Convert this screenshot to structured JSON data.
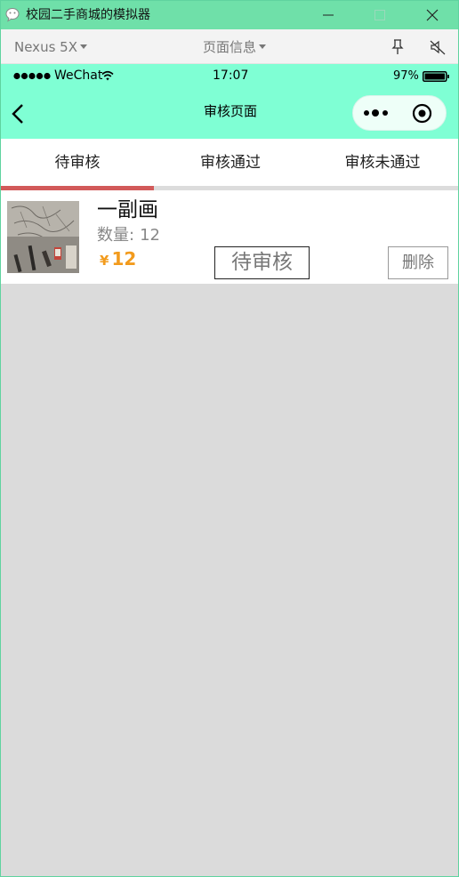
{
  "window": {
    "title": "校园二手商城的模拟器"
  },
  "toolbar": {
    "device": "Nexus 5X",
    "page_info": "页面信息"
  },
  "statusbar": {
    "carrier": "WeChat",
    "time": "17:07",
    "battery": "97%"
  },
  "navbar": {
    "title": "审核页面"
  },
  "tabs": [
    {
      "label": "待审核",
      "active": true
    },
    {
      "label": "审核通过",
      "active": false
    },
    {
      "label": "审核未通过",
      "active": false
    }
  ],
  "items": [
    {
      "name": "一副画",
      "qty_label": "数量:",
      "qty": "12",
      "price_symbol": "¥",
      "price": "12",
      "status": "待审核",
      "delete_label": "删除"
    }
  ],
  "colors": {
    "titlebar": "#6fe0a9",
    "header": "#7fffd4",
    "active_tab_underline": "#d25a5a",
    "price": "#f29b1d",
    "page_background": "#dbdbdb"
  },
  "icons": {
    "app": "wechat-icon",
    "back": "chevron-left-icon",
    "capsule_more": "more-dots-icon",
    "capsule_close": "target-close-icon",
    "pin": "pin-icon",
    "mute": "speaker-mute-icon"
  }
}
